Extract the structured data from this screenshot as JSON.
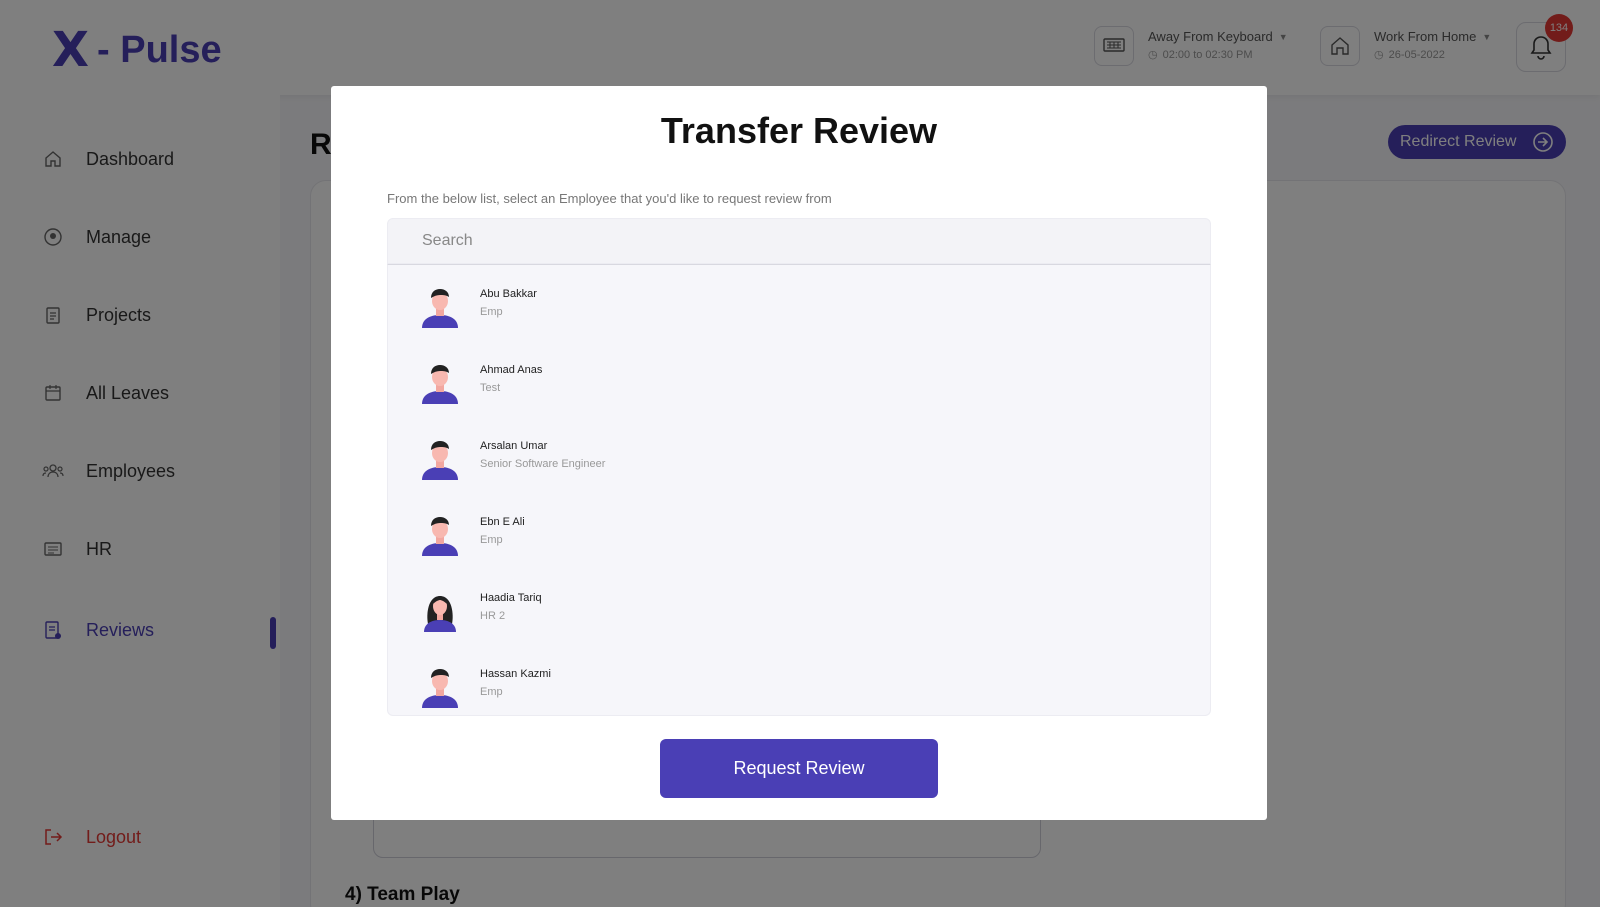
{
  "header": {
    "logo_mark": "X",
    "logo_text": "- Pulse",
    "status_away": {
      "label": "Away From Keyboard",
      "time": "02:00 to 02:30 PM"
    },
    "status_wfh": {
      "label": "Work From Home",
      "date": "26-05-2022"
    },
    "notification_count": "134"
  },
  "sidebar": {
    "items": [
      {
        "label": "Dashboard",
        "icon": "home-icon"
      },
      {
        "label": "Manage",
        "icon": "manage-icon"
      },
      {
        "label": "Projects",
        "icon": "clipboard-icon"
      },
      {
        "label": "All Leaves",
        "icon": "calendar-icon"
      },
      {
        "label": "Employees",
        "icon": "people-icon"
      },
      {
        "label": "HR",
        "icon": "list-icon"
      },
      {
        "label": "Reviews",
        "icon": "review-icon",
        "active": true
      }
    ],
    "logout_label": "Logout"
  },
  "page": {
    "title": "Re",
    "redirect_label": "Redirect Review",
    "section_title": "4) Team Play"
  },
  "modal": {
    "title": "Transfer Review",
    "subtitle": "From the below list, select an Employee that you'd like to request review from",
    "search_placeholder": "Search",
    "employees": [
      {
        "name": "Abu Bakkar",
        "role": "Emp",
        "avatar": "male"
      },
      {
        "name": "Ahmad Anas",
        "role": "Test",
        "avatar": "male"
      },
      {
        "name": "Arsalan Umar",
        "role": "Senior Software Engineer",
        "avatar": "male"
      },
      {
        "name": "Ebn E Ali",
        "role": "Emp",
        "avatar": "male"
      },
      {
        "name": "Haadia Tariq",
        "role": "HR 2",
        "avatar": "female"
      },
      {
        "name": "Hassan Kazmi",
        "role": "Emp",
        "avatar": "male"
      }
    ],
    "request_label": "Request Review"
  },
  "colors": {
    "accent": "#4a3fb5",
    "danger": "#e53935"
  }
}
